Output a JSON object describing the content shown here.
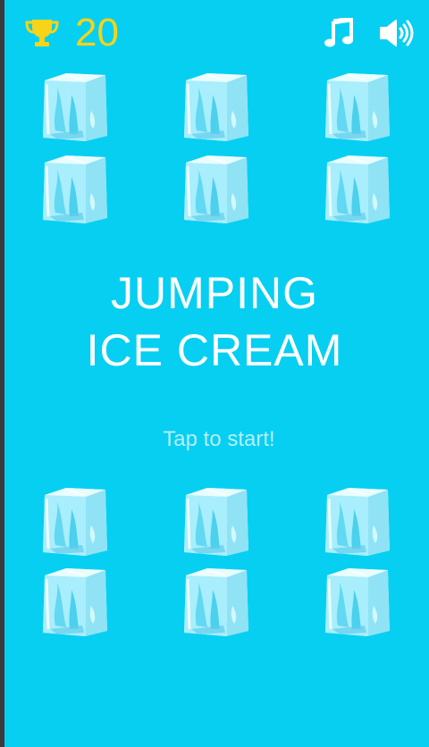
{
  "hud": {
    "score": "20",
    "trophy_icon": "trophy-icon",
    "music_icon": "music-note-icon",
    "sound_icon": "speaker-icon"
  },
  "title": {
    "line1": "JUMPING",
    "line2": "ICE CREAM"
  },
  "prompt": "Tap to start!",
  "colors": {
    "background": "#06CFF2",
    "score": "#F7D417",
    "title": "#FFFFFF",
    "prompt": "#B7EEF8",
    "ice": "#A8F2FF"
  },
  "ice_cubes": {
    "icon": "ice-cube-icon",
    "count": 12
  }
}
